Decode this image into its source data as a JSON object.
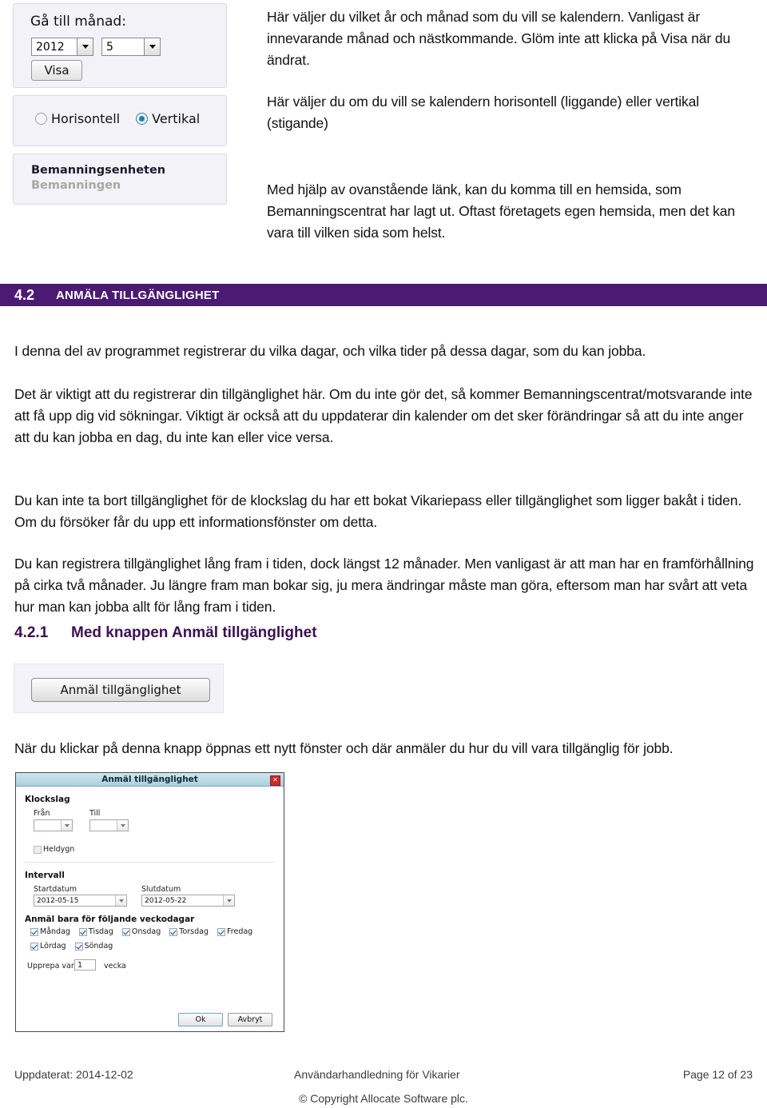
{
  "calendar_widget": {
    "goto_month_label": "Gå till månad:",
    "year_value": "2012",
    "month_value": "5",
    "show_button": "Visa",
    "orientation": {
      "horizontal_label": "Horisontell",
      "vertical_label": "Vertikal",
      "selected": "Vertikal"
    },
    "unit_name": "Bemanningsenheten",
    "unit_sub": "Bemanningen"
  },
  "intro": {
    "p1": "Här väljer du vilket år och månad som du vill se kalendern. Vanligast är innevarande månad och nästkommande. Glöm inte att klicka på Visa när du ändrat.",
    "p2": "Här väljer du om du vill se kalendern horisontell (liggande) eller vertikal (stigande)",
    "p3": "Med hjälp av ovanstående länk, kan du komma till en hemsida, som Bemanningscentrat har lagt ut. Oftast företagets egen hemsida, men det kan vara till vilken sida som helst."
  },
  "heading_42": {
    "number": "4.2",
    "title_first": "A",
    "title_rest": "NMÄLA TILLGÄNGLIGHET",
    "title_full": "ANMÄLA TILLGÄNGLIGHET",
    "band_color": "#4b1a72"
  },
  "section_42_body": {
    "p1": "I denna del av programmet registrerar du vilka dagar, och vilka tider på dessa dagar, som du kan jobba.",
    "p2": "Det är viktigt att du registrerar din tillgänglighet här. Om du inte gör det, så kommer Bemanningscentrat/motsvarande inte att få upp dig vid sökningar. Viktigt är också att du uppdaterar din kalender om det sker förändringar så att du inte anger att du kan jobba en dag, du inte kan eller vice versa.",
    "p3": "Du kan inte ta bort tillgänglighet för de klockslag du har ett bokat Vikariepass eller tillgänglighet som ligger bakåt i tiden. Om du försöker får du upp ett informationsfönster om detta.",
    "p4": "Du kan registrera tillgänglighet lång fram i tiden, dock längst 12 månader. Men vanligast är att man har en framförhållning på cirka två månader. Ju längre fram man bokar sig, ju mera ändringar måste man göra, eftersom man har svårt att veta hur man kan jobba allt för lång fram i tiden."
  },
  "heading_421": {
    "number": "4.2.1",
    "title": "Med knappen Anmäl tillgänglighet",
    "color": "#3b1053"
  },
  "report_button_shot": {
    "button_label": "Anmäl tillgänglighet"
  },
  "after_button_text": "När du klickar på denna knapp öppnas ett nytt fönster och där anmäler du hur du vill vara tillgänglig för jobb.",
  "dialog": {
    "title": "Anmäl tillgänglighet",
    "close_glyph": "✕",
    "klockslag": {
      "section_label": "Klockslag",
      "from_label": "Från",
      "from_value": "",
      "to_label": "Till",
      "to_value": "",
      "heldygn_label": "Heldygn",
      "heldygn_checked": false
    },
    "intervall": {
      "section_label": "Intervall",
      "startdatum_label": "Startdatum",
      "startdatum_value": "2012-05-15",
      "slutdatum_label": "Slutdatum",
      "slutdatum_value": "2012-05-22",
      "weekdays_label": "Anmäl bara för följande veckodagar",
      "weekdays": [
        {
          "label": "Måndag",
          "checked": true
        },
        {
          "label": "Tisdag",
          "checked": true
        },
        {
          "label": "Onsdag",
          "checked": true
        },
        {
          "label": "Torsdag",
          "checked": true
        },
        {
          "label": "Fredag",
          "checked": true
        },
        {
          "label": "Lördag",
          "checked": true
        },
        {
          "label": "Söndag",
          "checked": true
        }
      ],
      "repeat_prefix": "Upprepa var",
      "repeat_value": "1",
      "repeat_suffix": "vecka"
    },
    "ok_label": "Ok",
    "cancel_label": "Avbryt"
  },
  "footer": {
    "left": "Uppdaterat: 2014-12-02",
    "center": "Användarhandledning för Vikarier",
    "right": "Page 12 of 23",
    "copyright": "© Copyright Allocate Software plc."
  }
}
